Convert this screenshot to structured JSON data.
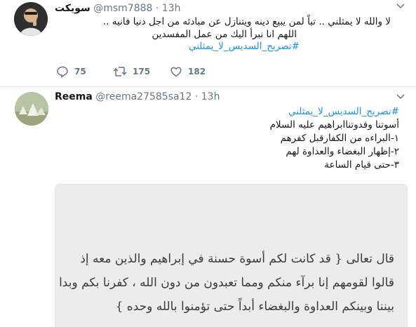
{
  "tweets": [
    {
      "name": "سويكت",
      "handle": "@msm7888",
      "time": "13h",
      "lines": [
        "لا والله لا يمثلني .. تباً لمن يبيع دينه ويتنازل عن مبادئه من اجل دنيا فانيه ..",
        "اللهم انا نبرأ اليك من عمل المفسدين"
      ],
      "hashtag": "#تصريح_السديس_لا_يمثلني",
      "reply_count": "75",
      "retweet_count": "175",
      "like_count": "182"
    },
    {
      "name": "Reema",
      "handle": "@reema27585sa12",
      "time": "13h",
      "hashtag": "#تصريح_السديس_لا_يمثلني",
      "lines": [
        "أسوتنا وقدوتناابراهيم عليه السلام",
        "١-البراءه من الكفارقبل كفرهم",
        "٢-إظهار البغضاء والعداوة لهم",
        "٣-حتى قيام الساعة"
      ],
      "image_text": [
        "قال تعالى { قد كانت لكم أسوة حسنة في إبراهيم والذين معه إذ",
        "قالوا لقومهم إنا برآء منكم ومما تعبدون من دون الله ، كفرنا بكم وبدا",
        "بيننا وبينكم العداوة والبغضاء أبداً حتى تؤمنوا بالله وحده }"
      ]
    }
  ],
  "icons": {
    "reply": "reply-icon",
    "retweet": "retweet-icon",
    "like": "heart-icon",
    "more": "chevron-down-icon"
  },
  "colors": {
    "hashtag": "#1b95e0",
    "secondary": "#657786",
    "divider": "#e6ecf0"
  }
}
